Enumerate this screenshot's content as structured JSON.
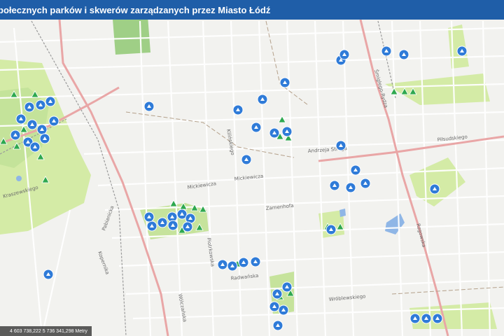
{
  "app": {
    "title": "połecznych parków i skwerów zarządzanych przez Miasto Łódź",
    "coordinates": "4 603 738,222 5 736 341,298 Metry"
  },
  "colors": {
    "title_bar": "#1f5ea8",
    "map_background": "#f2f2ef",
    "park_green": "#d4eba6",
    "forest_green": "#7cbf6e",
    "water_blue": "#8fb6e6",
    "main_road": "#e9a6a6",
    "marker_blue": "#2f7bd8",
    "marker_green": "#2ea84f"
  },
  "streets": [
    "Mickiewicza",
    "Mickiewicza",
    "Piłsudskiego",
    "Kilińskiego",
    "Piotrkowska",
    "Kopernika",
    "Pabianicka",
    "Radwańska",
    "Rzgowska",
    "Śmigłego-Rydza",
    "Kraszewskiego",
    "Andrzeja Struga",
    "Zamenhofa",
    "Wróblewskiego",
    "Wólczańska"
  ],
  "markers": {
    "blue_icon": "park-marker-icon",
    "green_icon": "tree-marker-icon"
  }
}
